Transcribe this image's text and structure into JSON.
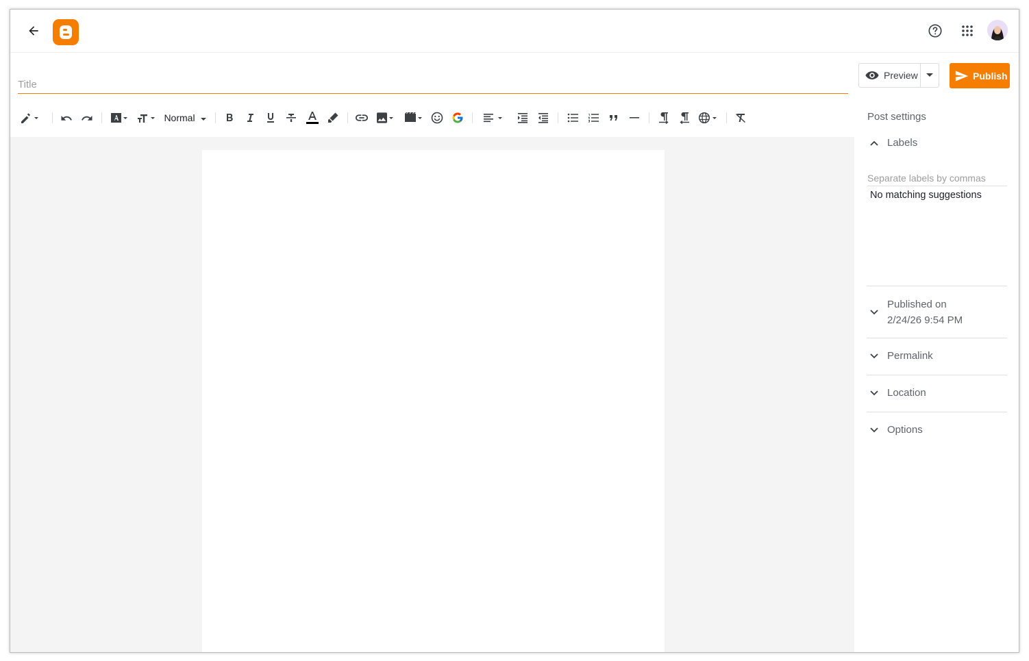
{
  "header": {
    "back_icon": "arrow-left-icon",
    "logo_icon": "blogger-logo",
    "help_icon": "help-circle-icon",
    "apps_icon": "apps-grid-icon",
    "avatar": "user-avatar"
  },
  "editor": {
    "title_placeholder": "Title",
    "paragraph_style": "Normal",
    "toolbar_icons": [
      "pencil-mode-icon",
      "undo-icon",
      "redo-icon",
      "font-icon",
      "font-size-icon",
      "bold-icon",
      "italic-icon",
      "underline-icon",
      "strikethrough-icon",
      "text-color-icon",
      "highlight-icon",
      "link-icon",
      "image-icon",
      "video-icon",
      "emoji-icon",
      "google-icon",
      "align-icon",
      "indent-icon",
      "outdent-icon",
      "bulleted-list-icon",
      "numbered-list-icon",
      "quote-icon",
      "horizontal-rule-icon",
      "ltr-icon",
      "rtl-icon",
      "language-icon",
      "clear-formatting-icon"
    ]
  },
  "actions": {
    "preview_label": "Preview",
    "publish_label": "Publish"
  },
  "settings": {
    "title": "Post settings",
    "labels": {
      "heading": "Labels",
      "placeholder": "Separate labels by commas",
      "suggestion_text": "No matching suggestions"
    },
    "published": {
      "label": "Published on",
      "date": "2/24/26 9:54 PM"
    },
    "permalink": "Permalink",
    "location": "Location",
    "options": "Options"
  },
  "colors": {
    "accent": "#f57d00",
    "editor_bg": "#f4f4f4",
    "text_secondary": "#5f6368"
  }
}
